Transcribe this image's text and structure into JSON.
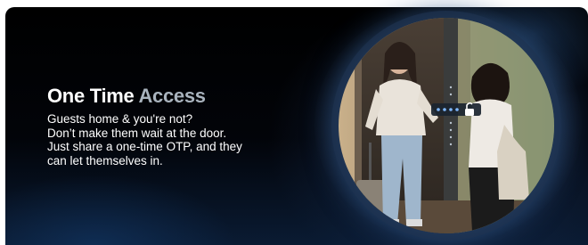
{
  "hero": {
    "title_main": "One Time",
    "title_accent": "Access",
    "lines": [
      "Guests home & you're not?",
      "Don’t make them wait at the door.",
      "Just share a one-time OTP, and they",
      "can let themselves in."
    ]
  },
  "photo": {
    "subject": "two-women-at-door-with-smart-lock",
    "lock_icon": "unlocked-padlock-icon"
  },
  "colors": {
    "title": "#ffffff",
    "title_accent": "#a9b3bd",
    "background_top": "#000000",
    "background_glow": "#1e3a63"
  }
}
